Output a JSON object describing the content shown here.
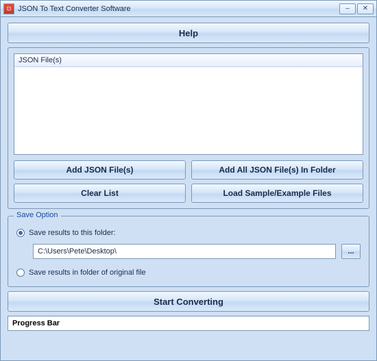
{
  "titlebar": {
    "title": "JSON To Text Converter Software"
  },
  "help_label": "Help",
  "file_list": {
    "header": "JSON File(s)"
  },
  "buttons": {
    "add_files": "Add JSON File(s)",
    "add_folder": "Add All JSON File(s) In Folder",
    "clear_list": "Clear List",
    "load_samples": "Load Sample/Example Files"
  },
  "save_option": {
    "group_title": "Save Option",
    "radio_to_folder": "Save results to this folder:",
    "path": "C:\\Users\\Pete\\Desktop\\",
    "browse_label": "...",
    "radio_original": "Save results in folder of original file"
  },
  "start_label": "Start Converting",
  "progress_label": "Progress Bar"
}
